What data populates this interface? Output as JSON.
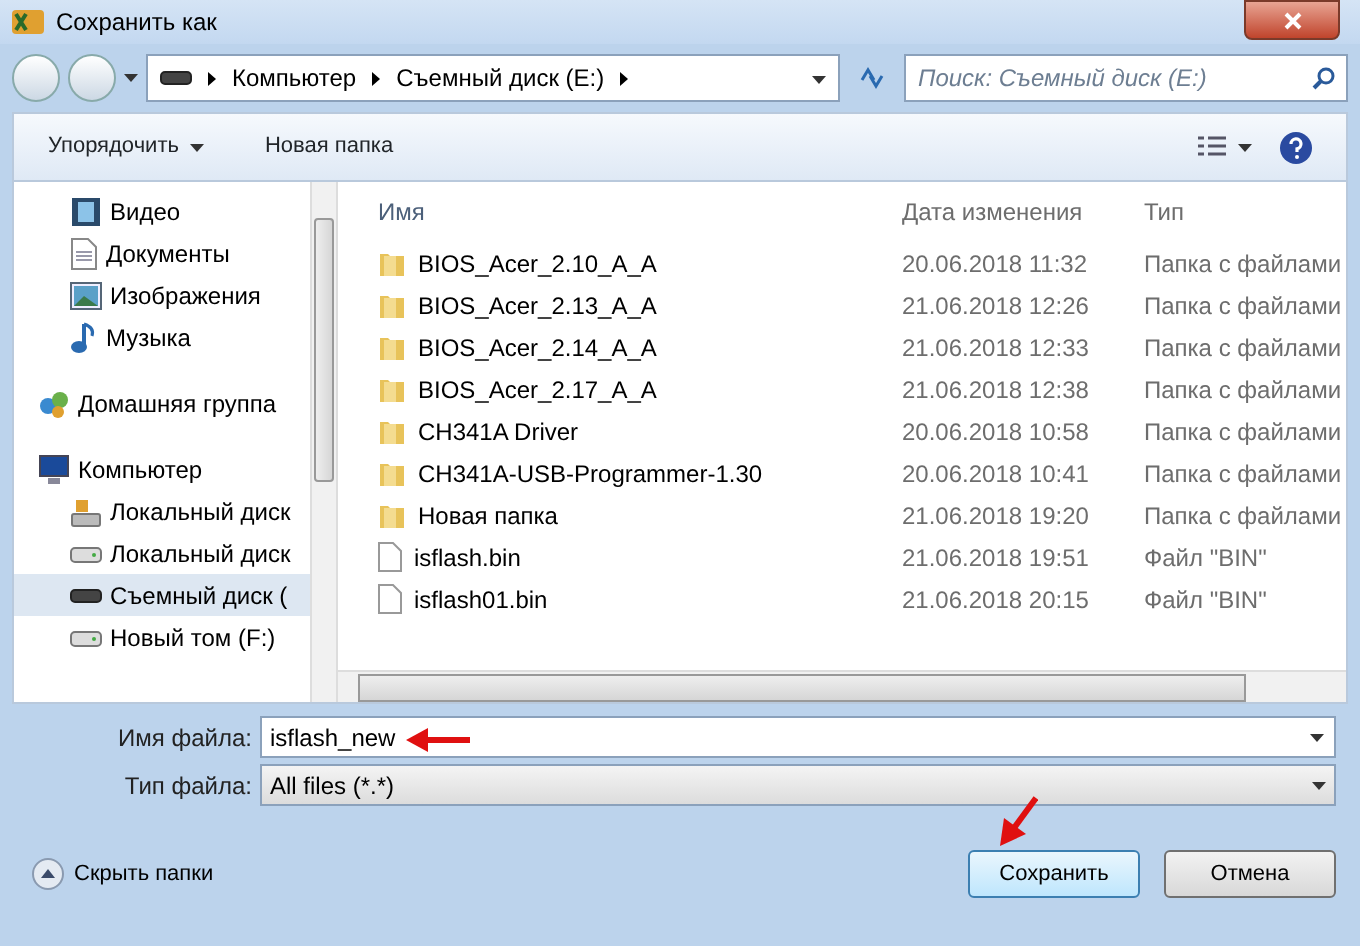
{
  "window": {
    "title": "Сохранить как"
  },
  "address": {
    "crumbs": [
      "Компьютер",
      "Съемный диск (E:)"
    ]
  },
  "search": {
    "placeholder": "Поиск: Съемный диск (E:)"
  },
  "toolbar": {
    "organize": "Упорядочить",
    "new_folder": "Новая папка"
  },
  "sidebar": [
    {
      "label": "Видео",
      "kind": "video",
      "selected": false
    },
    {
      "label": "Документы",
      "kind": "document",
      "selected": false
    },
    {
      "label": "Изображения",
      "kind": "image",
      "selected": false
    },
    {
      "label": "Музыка",
      "kind": "music",
      "selected": false
    },
    {
      "label": "Домашняя группа",
      "kind": "group",
      "selected": false
    },
    {
      "label": "Компьютер",
      "kind": "computer",
      "selected": false,
      "children": [
        {
          "label": "Локальный диск",
          "kind": "sysdrive",
          "selected": false
        },
        {
          "label": "Локальный диск",
          "kind": "drive",
          "selected": false
        },
        {
          "label": "Съемный диск (",
          "kind": "removable",
          "selected": true
        },
        {
          "label": "Новый том (F:)",
          "kind": "drive",
          "selected": false
        }
      ]
    }
  ],
  "table": {
    "columns": [
      "Имя",
      "Дата изменения",
      "Тип"
    ],
    "rows": [
      {
        "kind": "folder",
        "name": "BIOS_Acer_2.10_A_A",
        "date": "20.06.2018 11:32",
        "type": "Папка с файлами"
      },
      {
        "kind": "folder",
        "name": "BIOS_Acer_2.13_A_A",
        "date": "21.06.2018 12:26",
        "type": "Папка с файлами"
      },
      {
        "kind": "folder",
        "name": "BIOS_Acer_2.14_A_A",
        "date": "21.06.2018 12:33",
        "type": "Папка с файлами"
      },
      {
        "kind": "folder",
        "name": "BIOS_Acer_2.17_A_A",
        "date": "21.06.2018 12:38",
        "type": "Папка с файлами"
      },
      {
        "kind": "folder",
        "name": "CH341A Driver",
        "date": "20.06.2018 10:58",
        "type": "Папка с файлами"
      },
      {
        "kind": "folder",
        "name": "CH341A-USB-Programmer-1.30",
        "date": "20.06.2018 10:41",
        "type": "Папка с файлами"
      },
      {
        "kind": "folder",
        "name": "Новая папка",
        "date": "21.06.2018 19:20",
        "type": "Папка с файлами"
      },
      {
        "kind": "file",
        "name": "isflash.bin",
        "date": "21.06.2018 19:51",
        "type": "Файл \"BIN\""
      },
      {
        "kind": "file",
        "name": "isflash01.bin",
        "date": "21.06.2018 20:15",
        "type": "Файл \"BIN\""
      }
    ]
  },
  "filename": {
    "label": "Имя файла:",
    "value": "isflash_new"
  },
  "filetype": {
    "label": "Тип файла:",
    "value": "All files (*.*)"
  },
  "hide_folders": "Скрыть папки",
  "buttons": {
    "save": "Сохранить",
    "cancel": "Отмена"
  }
}
